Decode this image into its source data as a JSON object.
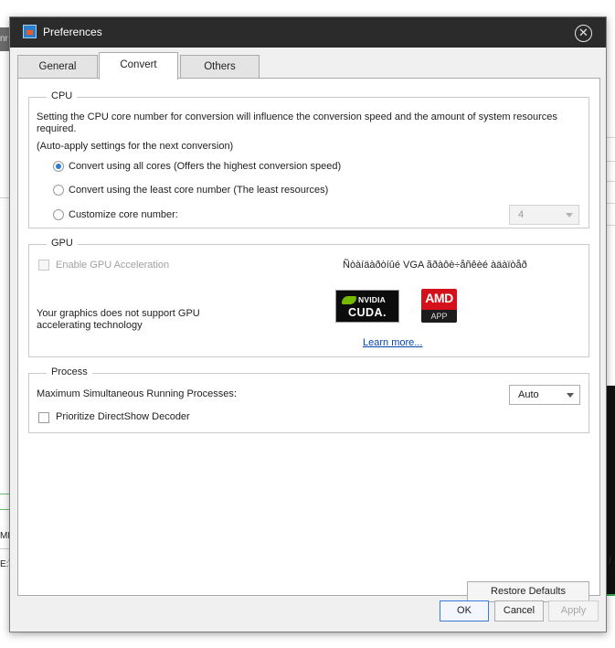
{
  "background": {
    "left_text_top": "nr",
    "left_text_mid": "MF",
    "left_text_low": "E:\\",
    "right_slash": "/"
  },
  "dialog": {
    "title": "Preferences",
    "close_glyph": "✕",
    "tabs": [
      {
        "label": "General",
        "active": false
      },
      {
        "label": "Convert",
        "active": true
      },
      {
        "label": "Others",
        "active": false
      }
    ],
    "cpu": {
      "group_title": "CPU",
      "description": "Setting the CPU core number for conversion will influence the conversion speed and the amount of system resources required.",
      "auto_apply_note": "(Auto-apply settings for the next conversion)",
      "options": [
        {
          "label": "Convert using all cores (Offers the highest conversion speed)",
          "checked": true
        },
        {
          "label": "Convert using the least core number (The least resources)",
          "checked": false
        },
        {
          "label": "Customize core number:",
          "checked": false
        }
      ],
      "core_number_value": "4"
    },
    "gpu": {
      "group_title": "GPU",
      "enable_label": "Enable GPU Acceleration",
      "garbled_text": "Ñòàíäàðòíûé VGA ãðàôè÷åñêèé àäàïòåð",
      "not_supported": "Your graphics does not support GPU accelerating technology",
      "nvidia_name": "NVIDIA",
      "nvidia_cuda": "CUDA.",
      "amd_name": "AMD",
      "amd_app": "APP",
      "learn_more": "Learn more..."
    },
    "process": {
      "group_title": "Process",
      "max_label": "Maximum Simultaneous Running Processes:",
      "max_value": "Auto",
      "directshow_label": "Prioritize DirectShow Decoder"
    },
    "restore_defaults": "Restore Defaults",
    "ok": "OK",
    "cancel": "Cancel",
    "apply": "Apply"
  },
  "colors": {
    "titlebar": "#2b2b2b",
    "radio_accent": "#2a7fd4",
    "link": "#0645ad",
    "nvidia_green": "#76b900",
    "amd_red": "#d4111a"
  }
}
